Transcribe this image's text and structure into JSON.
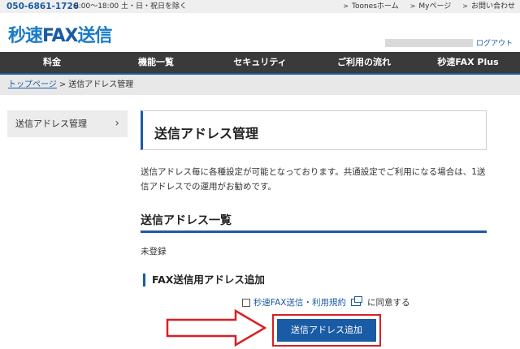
{
  "topbar": {
    "phone": "050-6861-1726",
    "hours": "9:00〜18:00 土・日・祝日を除く",
    "links": [
      "Toonesホーム",
      "Myページ",
      "お問い合わせ"
    ]
  },
  "logo": {
    "part1": "秒速",
    "part2": "FAX",
    "part3": "送信"
  },
  "account": {
    "logout": "ログアウト"
  },
  "nav": {
    "items": [
      "料金",
      "機能一覧",
      "セキュリティ",
      "ご利用の流れ",
      "秒速FAX Plus"
    ]
  },
  "breadcrumb": {
    "home": "トップページ",
    "separator": ">",
    "current": "送信アドレス管理"
  },
  "sidebar": {
    "item": "送信アドレス管理"
  },
  "main": {
    "title": "送信アドレス管理",
    "description": "送信アドレス毎に各種設定が可能となっております。共通設定でご利用になる場合は、1送信アドレスでの運用がお勧めです。",
    "list_heading": "送信アドレス一覧",
    "empty_text": "未登録",
    "add_heading": "FAX送信用アドレス追加",
    "terms_link": "秒速FAX送信・利用規約",
    "terms_suffix": "に同意する",
    "add_button": "送信アドレス追加"
  },
  "colors": {
    "primary": "#1a5ba5",
    "nav_bg": "#3a3a3a",
    "highlight": "#d81f26"
  }
}
